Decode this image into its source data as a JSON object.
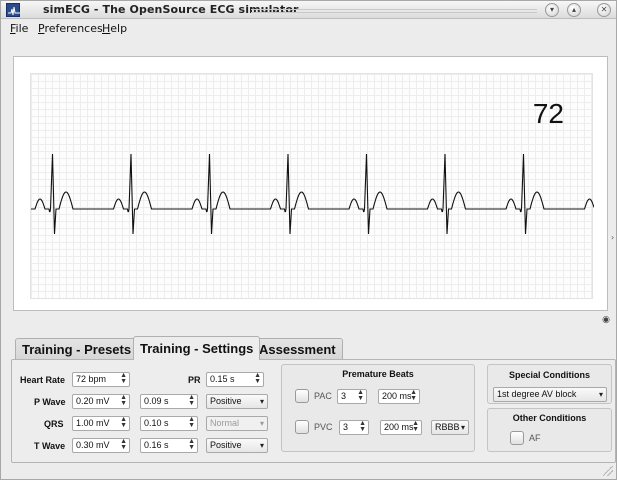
{
  "window": {
    "title": "simECG - The OpenSource ECG simulator"
  },
  "menu": [
    {
      "label": "File",
      "mnemonic": "F",
      "rest": "ile"
    },
    {
      "label": "Preferences",
      "mnemonic": "P",
      "rest": "references"
    },
    {
      "label": "Help",
      "mnemonic": "H",
      "rest": "elp"
    }
  ],
  "monitor": {
    "heart_rate_display": "72"
  },
  "tabs": [
    {
      "label": "Training - Presets",
      "active": false
    },
    {
      "label": "Training - Settings",
      "active": true
    },
    {
      "label": "Assessment",
      "active": false
    }
  ],
  "settings": {
    "heart_rate": {
      "label": "Heart Rate",
      "value": "72 bpm"
    },
    "pr": {
      "label": "PR",
      "value": "0.15 s"
    },
    "p_wave": {
      "label": "P Wave",
      "amplitude": "0.20 mV",
      "duration": "0.09 s",
      "polarity": "Positive"
    },
    "qrs": {
      "label": "QRS",
      "amplitude": "1.00 mV",
      "duration": "0.10 s",
      "polarity": "Normal",
      "polarity_disabled": true
    },
    "t_wave": {
      "label": "T Wave",
      "amplitude": "0.30 mV",
      "duration": "0.16 s",
      "polarity": "Positive"
    }
  },
  "premature_beats": {
    "title": "Premature Beats",
    "pac": {
      "label": "PAC",
      "count": "3",
      "interval": "200 ms"
    },
    "pvc": {
      "label": "PVC",
      "count": "3",
      "interval": "200 ms",
      "morphology": "RBBB"
    }
  },
  "special_conditions": {
    "title": "Special Conditions",
    "selected": "1st degree AV block"
  },
  "other_conditions": {
    "title": "Other Conditions",
    "af": {
      "label": "AF",
      "checked": false
    }
  },
  "icons": {
    "spin_arrows": "⇕",
    "dropdown": "▾",
    "minimize": "▾",
    "maximize": "▴",
    "close": "✕"
  }
}
